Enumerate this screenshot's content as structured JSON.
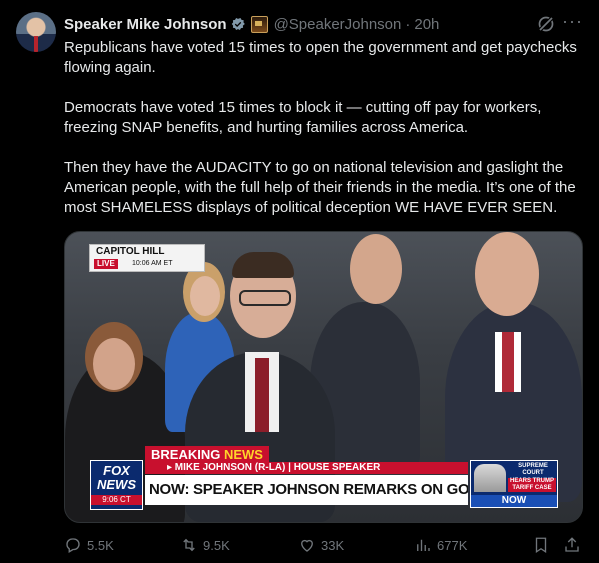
{
  "author": {
    "name": "Speaker Mike Johnson",
    "handle": "@SpeakerJohnson",
    "separator": "·",
    "time": "20h"
  },
  "post": {
    "paragraphs": [
      "Republicans have voted 15 times to open the government and get paychecks flowing again.",
      "Democrats have voted 15 times to block it — cutting off pay for workers, freezing SNAP benefits, and hurting families across America.",
      "Then they have the AUDACITY to go on national television and gaslight the American people, with the full help of their friends in the media. It’s one of the most SHAMELESS displays of political deception WE HAVE EVER SEEN."
    ]
  },
  "media": {
    "location": "CAPITOL HILL",
    "live": "LIVE",
    "live_time": "10:06 AM ET",
    "breaking_1": "BREAKING",
    "breaking_2": "NEWS",
    "subtitle": "▸ MIKE JOHNSON (R-LA) | HOUSE SPEAKER",
    "headline": "NOW: SPEAKER JOHNSON REMARKS ON GOVT SHUTDOWN",
    "network_1": "FOX",
    "network_2": "NEWS",
    "network_time": "9:06 CT",
    "side_1": "SUPREME COURT",
    "side_2": "HEARS TRUMP TARIFF CASE",
    "side_3": "NOW"
  },
  "actions": {
    "replies": "5.5K",
    "reposts": "9.5K",
    "likes": "33K",
    "views": "677K"
  },
  "icons": [
    "verified-badge-icon",
    "affiliate-badge-icon",
    "grok-icon",
    "more-icon",
    "reply-icon",
    "repost-icon",
    "like-icon",
    "views-icon",
    "bookmark-icon",
    "share-icon"
  ],
  "colors": {
    "background": "#000000",
    "text": "#e7e9ea",
    "muted": "#71767b",
    "verified": "#1d9bf0",
    "fox_red": "#c8102e",
    "fox_blue": "#0b2a6e"
  }
}
